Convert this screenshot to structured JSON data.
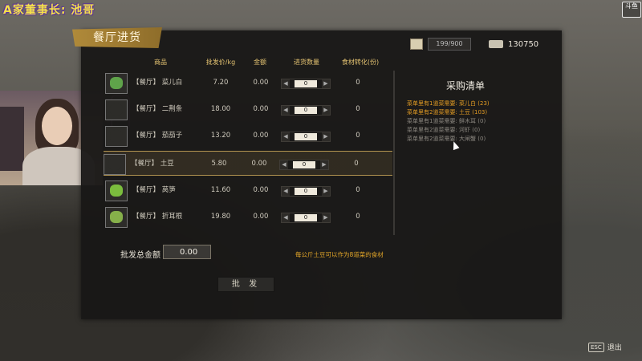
{
  "overlay": {
    "streamer_title": "A家董事长: 池哥",
    "douyu_logo_text": "斗鱼"
  },
  "panel": {
    "title": "餐厅进货",
    "capacity": "199/900",
    "money": "130750"
  },
  "table": {
    "headers": [
      "商品",
      "批发价/kg",
      "金额",
      "进货数量",
      "食材转化(份)"
    ],
    "rows": [
      {
        "name": "【餐厅】 菜儿白",
        "price": "7.20",
        "amount": "0.00",
        "qty": "0",
        "conv": "0",
        "icon": "cabbage-icon",
        "color": "#5fa34a"
      },
      {
        "name": "【餐厅】 二荆条",
        "price": "18.00",
        "amount": "0.00",
        "qty": "0",
        "conv": "0",
        "icon": "chili-icon",
        "color": "#2d2c29"
      },
      {
        "name": "【餐厅】 茄茄子",
        "price": "13.20",
        "amount": "0.00",
        "qty": "0",
        "conv": "0",
        "icon": "eggplant-icon",
        "color": "#2d2c29"
      },
      {
        "name": "【餐厅】 土豆",
        "price": "5.80",
        "amount": "0.00",
        "qty": "0",
        "conv": "0",
        "icon": "potato-icon",
        "color": "#2d2c29",
        "selected": true
      },
      {
        "name": "【餐厅】 莴笋",
        "price": "11.60",
        "amount": "0.00",
        "qty": "0",
        "conv": "0",
        "icon": "lettuce-stem-icon",
        "color": "#7bbd3d"
      },
      {
        "name": "【餐厅】 折耳根",
        "price": "19.80",
        "amount": "0.00",
        "qty": "0",
        "conv": "0",
        "icon": "houttuynia-icon",
        "color": "#86b04a"
      }
    ]
  },
  "footer": {
    "total_label": "批发总金额",
    "total_value": "0.00",
    "hint": "每公斤土豆可以作为8道菜的食材",
    "buy_label": "批 发"
  },
  "orders": {
    "title": "采购清单",
    "items": [
      {
        "text": "菜单里有1道菜需要: 菜儿白 (23)",
        "active": true
      },
      {
        "text": "菜单里有2道菜需要: 土豆 (103)",
        "active": true
      },
      {
        "text": "菜单里有1道菜需要: 鲜木耳 (0)",
        "active": false
      },
      {
        "text": "菜单里有2道菜需要: 河虾 (0)",
        "active": false
      },
      {
        "text": "菜单里有2道菜需要: 大闸蟹 (0)",
        "active": false
      }
    ]
  },
  "esc": {
    "key": "ESC",
    "label": "退出"
  }
}
